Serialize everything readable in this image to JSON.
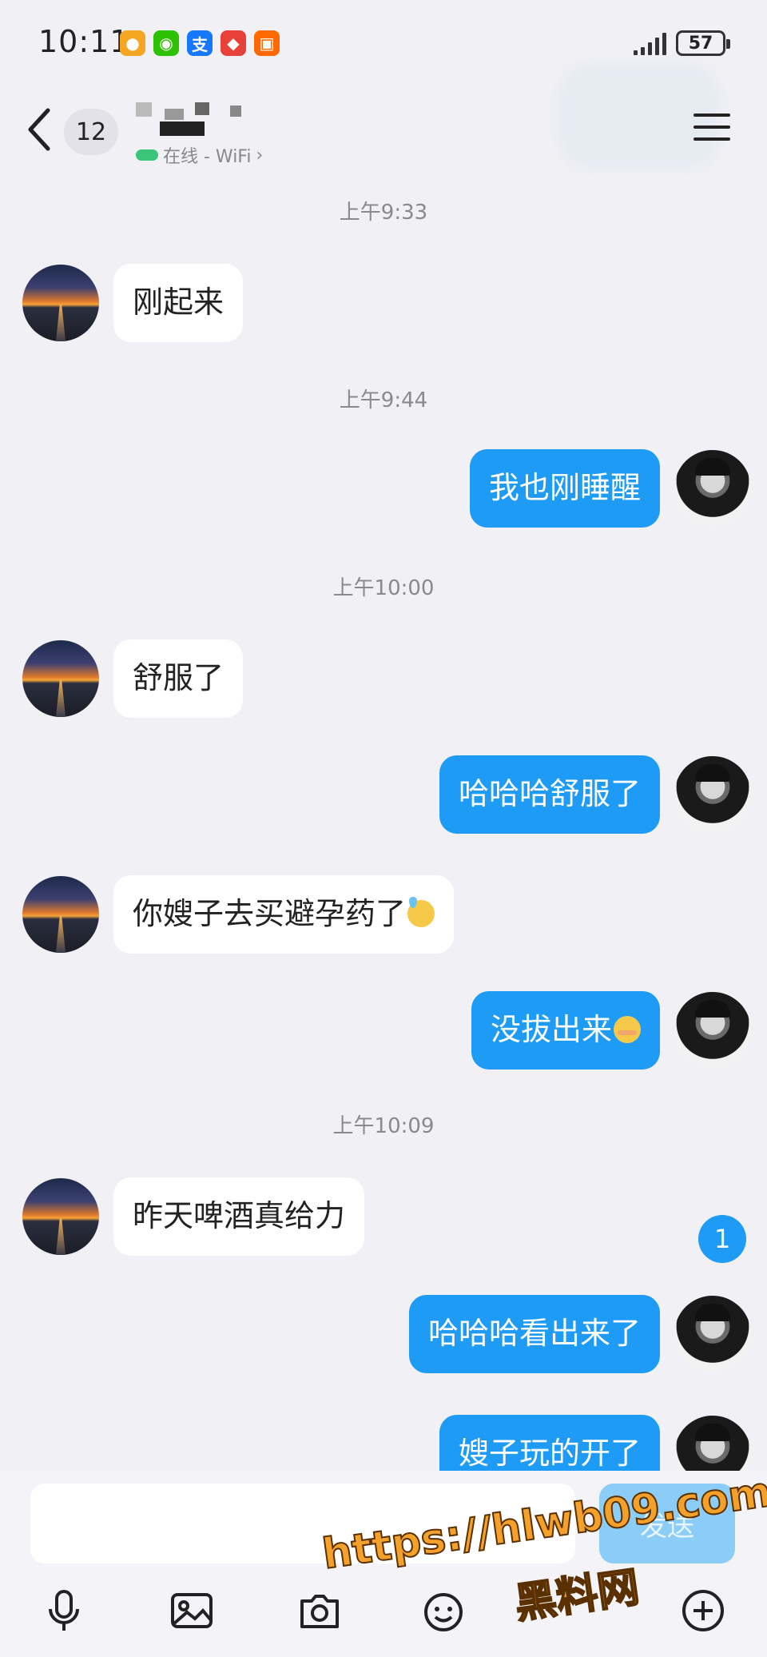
{
  "status_bar": {
    "time": "10:11",
    "battery": "57",
    "app_icons": [
      "weibo-icon",
      "wechat-icon",
      "alipay-icon",
      "news-icon",
      "shop-icon"
    ]
  },
  "header": {
    "unread_count": "12",
    "contact_status": "在线 - WiFi"
  },
  "messages": [
    {
      "type": "time",
      "text": "上午9:33"
    },
    {
      "type": "in",
      "text": "刚起来"
    },
    {
      "type": "time",
      "text": "上午9:44"
    },
    {
      "type": "out",
      "text": "我也刚睡醒"
    },
    {
      "type": "time",
      "text": "上午10:00"
    },
    {
      "type": "in",
      "text": "舒服了"
    },
    {
      "type": "out",
      "text": "哈哈哈舒服了"
    },
    {
      "type": "in",
      "text": "你嫂子去买避孕药了",
      "emoji": "sweat-emoji"
    },
    {
      "type": "out",
      "text": "没拔出来",
      "emoji": "blush-emoji"
    },
    {
      "type": "time",
      "text": "上午10:09"
    },
    {
      "type": "in",
      "text": "昨天啤酒真给力"
    },
    {
      "type": "out",
      "text": "哈哈哈看出来了"
    },
    {
      "type": "out",
      "text": "嫂子玩的开了"
    }
  ],
  "new_message_badge": "1",
  "input": {
    "send_label": "发送"
  },
  "toolbar": [
    "microphone-icon",
    "image-icon",
    "camera-icon",
    "emoji-icon",
    "plus-icon"
  ],
  "watermark": {
    "url": "https://hlwb09.com",
    "name": "黑料网"
  },
  "colors": {
    "background": "#f0f0f5",
    "outgoing_bubble": "#1e9bf5",
    "incoming_bubble": "#ffffff",
    "watermark": "#f3a12a"
  }
}
